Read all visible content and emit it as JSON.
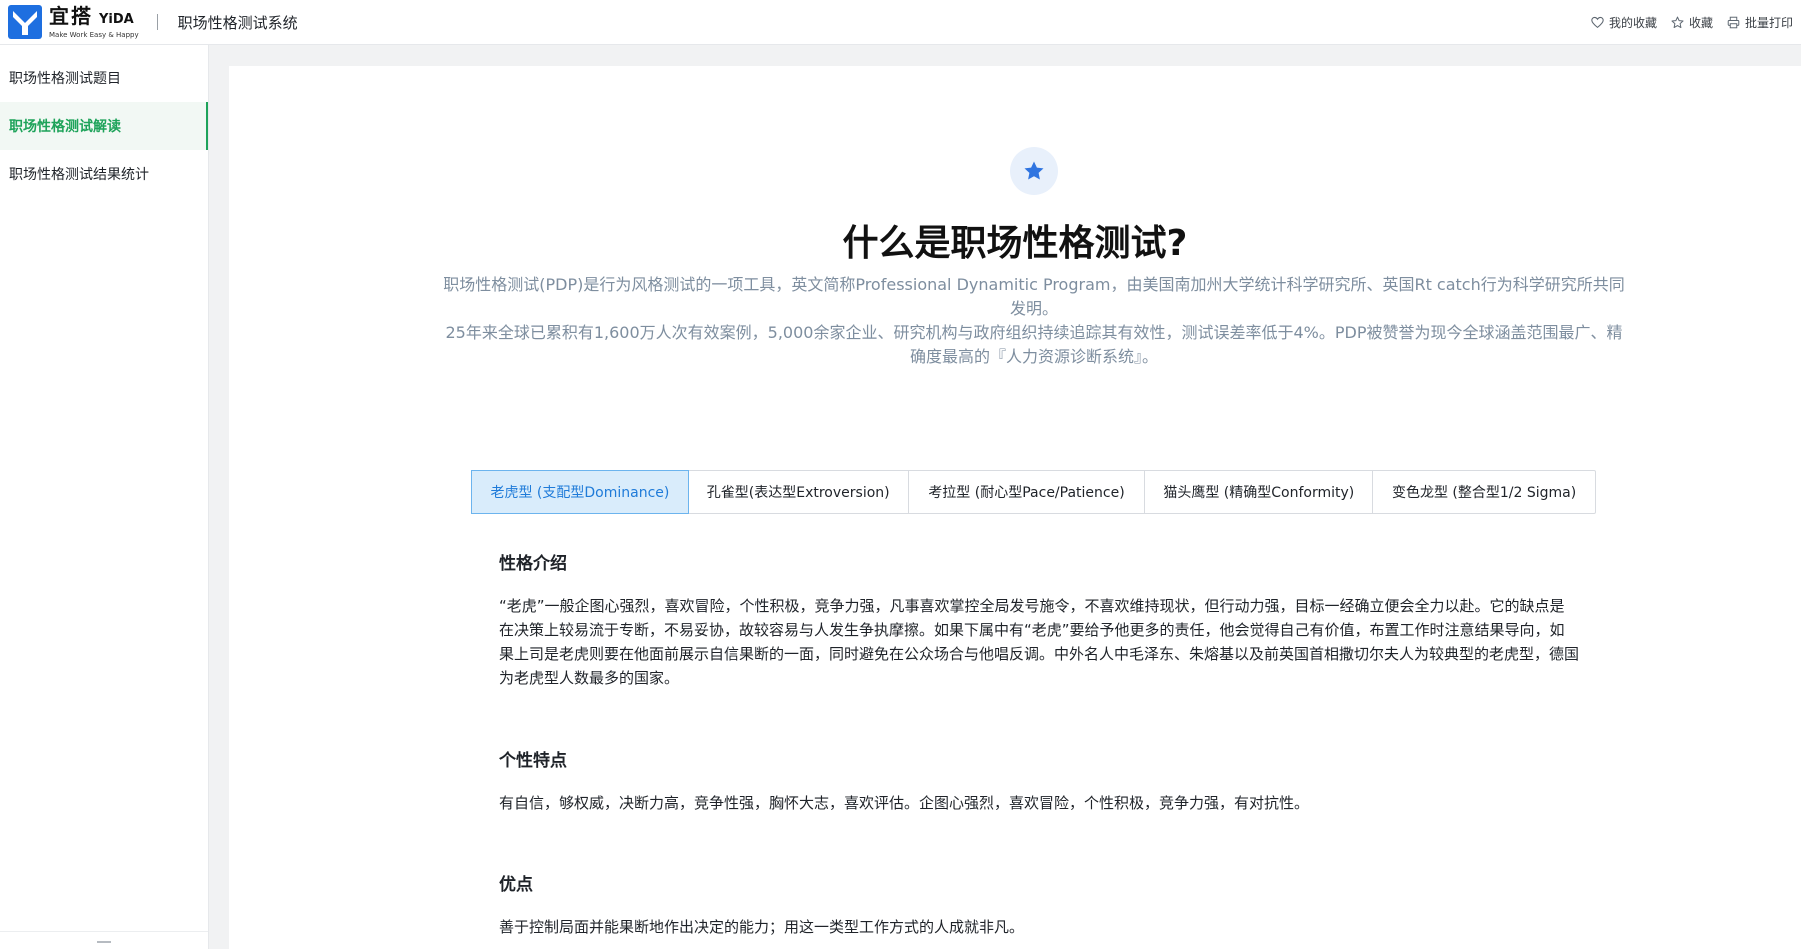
{
  "header": {
    "logo_cn": "宜搭",
    "logo_en": "YiDA",
    "logo_tagline": "Make Work Easy & Happy",
    "app_title": "职场性格测试系统",
    "actions": [
      {
        "label": "我的收藏",
        "icon": "heart-icon"
      },
      {
        "label": "收藏",
        "icon": "star-icon"
      },
      {
        "label": "批量打印",
        "icon": "printer-icon"
      }
    ]
  },
  "sidebar": {
    "items": [
      {
        "label": "职场性格测试题目",
        "active": false
      },
      {
        "label": "职场性格测试解读",
        "active": true
      },
      {
        "label": "职场性格测试结果统计",
        "active": false
      }
    ],
    "active_color": "#1ea35a"
  },
  "hero": {
    "icon": "star-icon",
    "title": "什么是职场性格测试?",
    "description_lines": [
      "职场性格测试(PDP)是行为风格测试的一项工具，英文简称Professional Dynamitic Program，由美国南加州大学统计科学研究所、英国Rt catch行为科学研究所共同发明。",
      "25年来全球已累积有1,600万人次有效案例，5,000余家企业、研究机构与政府组织持续追踪其有效性，测试误差率低于4%。PDP被赞誉为现今全球涵盖范围最广、精确度最高的『人力资源诊断系统』。"
    ]
  },
  "tabs": [
    {
      "label": "老虎型 (支配型Dominance)",
      "active": true
    },
    {
      "label": "孔雀型(表达型Extroversion)",
      "active": false
    },
    {
      "label": "考拉型 (耐心型Pace/Patience)",
      "active": false
    },
    {
      "label": "猫头鹰型 (精确型Conformity)",
      "active": false
    },
    {
      "label": "变色龙型 (整合型1/2 Sigma)",
      "active": false
    }
  ],
  "content": {
    "intro_title": "性格介绍",
    "intro_body": "“老虎”一般企图心强烈，喜欢冒险，个性积极，竞争力强，凡事喜欢掌控全局发号施令，不喜欢维持现状，但行动力强，目标一经确立便会全力以赴。它的缺点是在决策上较易流于专断，不易妥协，故较容易与人发生争执摩擦。如果下属中有“老虎”要给予他更多的责任，他会觉得自己有价值，布置工作时注意结果导向，如果上司是老虎则要在他面前展示自信果断的一面，同时避免在公众场合与他唱反调。中外名人中毛泽东、朱熔基以及前英国首相撒切尔夫人为较典型的老虎型，德国为老虎型人数最多的国家。",
    "traits_title": "个性特点",
    "traits_body": "有自信，够权威，决断力高，竞争性强，胸怀大志，喜欢评估。企图心强烈，喜欢冒险，个性积极，竞争力强，有对抗性。",
    "strengths_title": "优点",
    "strengths_body": "善于控制局面并能果断地作出决定的能力；用这一类型工作方式的人成就非凡。"
  },
  "colors": {
    "accent_blue": "#1f7bd9",
    "star_blue": "#2f74e0",
    "logo_blue": "#1e6fe0"
  }
}
